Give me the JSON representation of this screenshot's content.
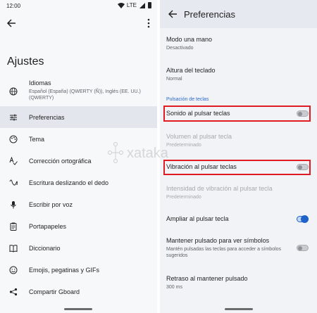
{
  "left": {
    "status": {
      "time": "12:00",
      "network": "LTE"
    },
    "title": "Ajustes",
    "items": [
      {
        "label": "Idiomas",
        "sub": "Español (España) (QWERTY (Ñ)), Inglés (EE. UU.) (QWERTY)"
      },
      {
        "label": "Preferencias"
      },
      {
        "label": "Tema"
      },
      {
        "label": "Corrección ortográfica"
      },
      {
        "label": "Escritura deslizando el dedo"
      },
      {
        "label": "Escribir por voz"
      },
      {
        "label": "Portapapeles"
      },
      {
        "label": "Diccionario"
      },
      {
        "label": "Emojis, pegatinas y GIFs"
      },
      {
        "label": "Compartir Gboard"
      }
    ]
  },
  "right": {
    "title": "Preferencias",
    "items": [
      {
        "title": "Modo una mano",
        "sub": "Desactivado"
      },
      {
        "title": "Altura del teclado",
        "sub": "Normal"
      },
      {
        "title": "Pulsación de teclas"
      },
      {
        "title": "Sonido al pulsar teclas",
        "toggle": false
      },
      {
        "title": "Volumen al pulsar tecla",
        "sub": "Predeterminado"
      },
      {
        "title": "Vibración al pulsar teclas",
        "toggle": false
      },
      {
        "title": "Intensidad de vibración al pulsar tecla",
        "sub": "Predeterminado"
      },
      {
        "title": "Ampliar al pulsar tecla",
        "toggle": true
      },
      {
        "title": "Mantener pulsado para ver símbolos",
        "sub": "Mantén pulsadas las teclas para acceder a símbolos sugeridos",
        "toggle": false
      },
      {
        "title": "Retraso al mantener pulsado",
        "sub": "300 ms"
      }
    ]
  },
  "watermark": {
    "brand": "xataka"
  },
  "colors": {
    "accent": "#1f62c9",
    "highlight": "#e01b24",
    "selected": "#e3e7ed"
  }
}
